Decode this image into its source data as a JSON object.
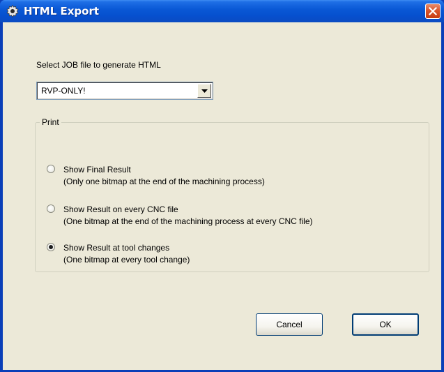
{
  "window": {
    "title": "HTML Export",
    "icon": "gear-icon",
    "close_icon": "close-icon"
  },
  "job": {
    "prompt": "Select JOB file to generate HTML",
    "selected": "RVP-ONLY!"
  },
  "print_group": {
    "legend": "Print",
    "options": [
      {
        "label": "Show Final Result",
        "description": "(Only one bitmap at the end of the machining process)",
        "checked": false
      },
      {
        "label": "Show Result on every CNC file",
        "description": "(One bitmap at the end of the machining process at every CNC file)",
        "checked": false
      },
      {
        "label": "Show Result at tool changes",
        "description": "(One bitmap at every tool change)",
        "checked": true
      }
    ]
  },
  "buttons": {
    "cancel": "Cancel",
    "ok": "OK"
  },
  "colors": {
    "titlebar": "#0a59d6",
    "close_button": "#d9552c",
    "dialog_bg": "#ece9d8"
  }
}
